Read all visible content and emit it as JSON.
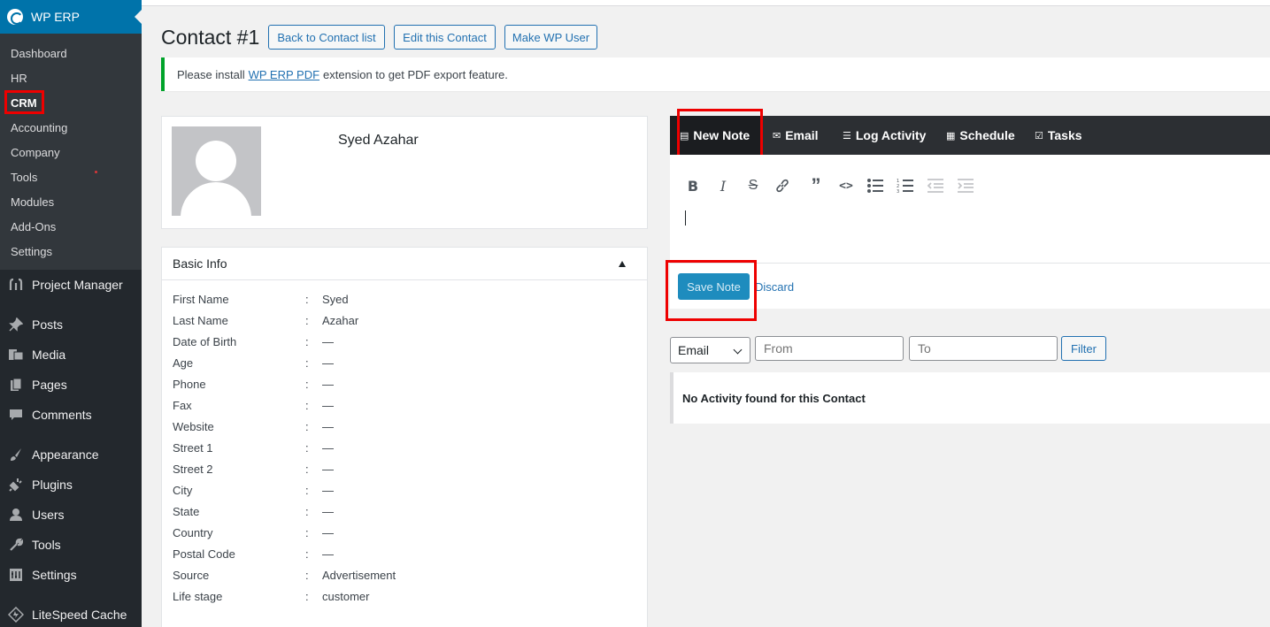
{
  "sidebar": {
    "brand": "WP ERP",
    "submenu": [
      {
        "label": "Dashboard"
      },
      {
        "label": "HR"
      },
      {
        "label": "CRM"
      },
      {
        "label": "Accounting"
      },
      {
        "label": "Company"
      },
      {
        "label": "Tools"
      },
      {
        "label": "Modules"
      },
      {
        "label": "Add-Ons"
      },
      {
        "label": "Settings"
      }
    ],
    "menu": [
      {
        "label": "Project Manager",
        "icon": "project-manager-icon"
      },
      {
        "label": "Posts",
        "icon": "pin-icon"
      },
      {
        "label": "Media",
        "icon": "media-icon"
      },
      {
        "label": "Pages",
        "icon": "pages-icon"
      },
      {
        "label": "Comments",
        "icon": "comment-icon"
      },
      {
        "label": "Appearance",
        "icon": "brush-icon"
      },
      {
        "label": "Plugins",
        "icon": "plugin-icon"
      },
      {
        "label": "Users",
        "icon": "user-icon"
      },
      {
        "label": "Tools",
        "icon": "wrench-icon"
      },
      {
        "label": "Settings",
        "icon": "settings-icon"
      },
      {
        "label": "LiteSpeed Cache",
        "icon": "litespeed-icon"
      }
    ]
  },
  "header": {
    "title": "Contact #1",
    "back_button": "Back to Contact list",
    "edit_button": "Edit this Contact",
    "wp_user_button": "Make WP User"
  },
  "notice": {
    "prefix": "Please install",
    "link": "WP ERP PDF",
    "suffix": "extension to get PDF export feature."
  },
  "profile": {
    "name": "Syed Azahar"
  },
  "basic_info": {
    "title": "Basic Info",
    "rows": [
      {
        "label": "First Name",
        "value": "Syed"
      },
      {
        "label": "Last Name",
        "value": "Azahar"
      },
      {
        "label": "Date of Birth",
        "value": "—"
      },
      {
        "label": "Age",
        "value": "—"
      },
      {
        "label": "Phone",
        "value": "—"
      },
      {
        "label": "Fax",
        "value": "—"
      },
      {
        "label": "Website",
        "value": "—"
      },
      {
        "label": "Street 1",
        "value": "—"
      },
      {
        "label": "Street 2",
        "value": "—"
      },
      {
        "label": "City",
        "value": "—"
      },
      {
        "label": "State",
        "value": "—"
      },
      {
        "label": "Country",
        "value": "—"
      },
      {
        "label": "Postal Code",
        "value": "—"
      },
      {
        "label": "Source",
        "value": "Advertisement"
      },
      {
        "label": "Life stage",
        "value": "customer"
      }
    ],
    "separator": ":"
  },
  "activity": {
    "tabs": [
      {
        "label": "New Note"
      },
      {
        "label": "Email"
      },
      {
        "label": "Log Activity"
      },
      {
        "label": "Schedule"
      },
      {
        "label": "Tasks"
      }
    ],
    "save_button": "Save Note",
    "discard_link": "Discard",
    "filter": {
      "type_selected": "Email",
      "from_placeholder": "From",
      "to_placeholder": "To",
      "button": "Filter"
    },
    "empty_message": "No Activity found for this Contact"
  },
  "colors": {
    "admin_bar": "#23282d",
    "brand": "#0073aa",
    "annotation_box": "#e00000",
    "notice_border": "#00a32a"
  }
}
